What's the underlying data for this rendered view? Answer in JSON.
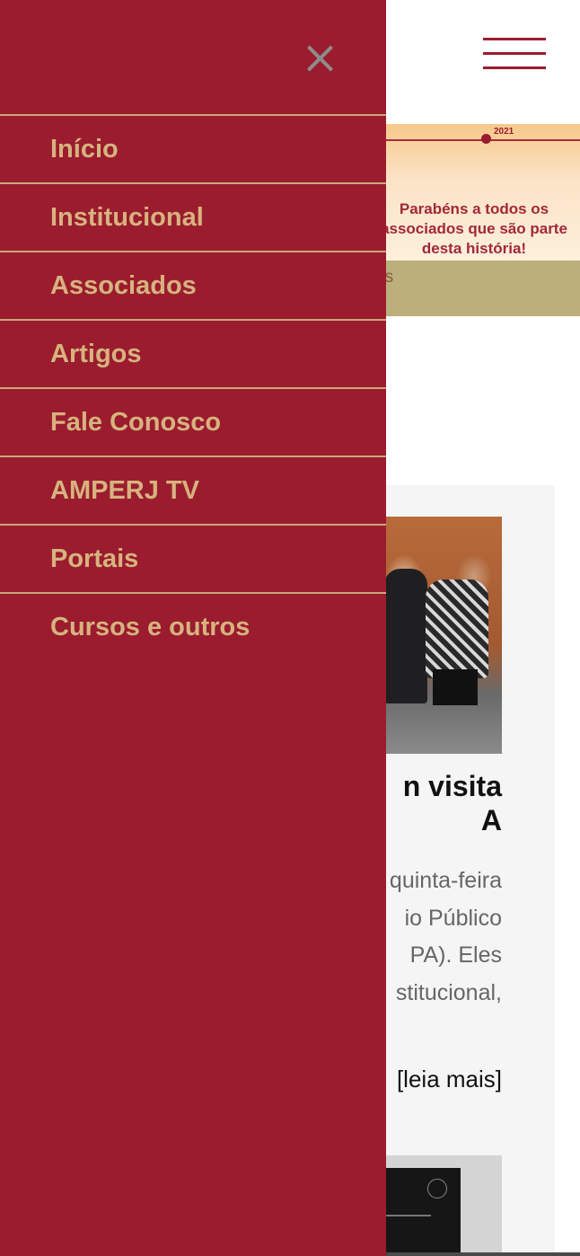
{
  "header": {
    "menu_icon": "hamburger-menu-icon"
  },
  "banner": {
    "year": "2021",
    "message": "Parabéns a todos os associados que são parte desta história!",
    "strip_text": "as"
  },
  "post": {
    "title": "n visita\nA",
    "excerpt": "quinta-feira\nio Público\nPA). Eles\nstitucional,",
    "read_more": "[leia mais]"
  },
  "drawer": {
    "close_icon": "close-icon",
    "items": [
      {
        "label": "Início"
      },
      {
        "label": "Institucional"
      },
      {
        "label": "Associados"
      },
      {
        "label": "Artigos"
      },
      {
        "label": "Fale Conosco"
      },
      {
        "label": "AMPERJ TV"
      },
      {
        "label": "Portais"
      },
      {
        "label": "Cursos e outros"
      }
    ]
  },
  "colors": {
    "brand": "#9b1c2e",
    "menu_text": "#d7b37f",
    "divider": "#c9a87a"
  }
}
